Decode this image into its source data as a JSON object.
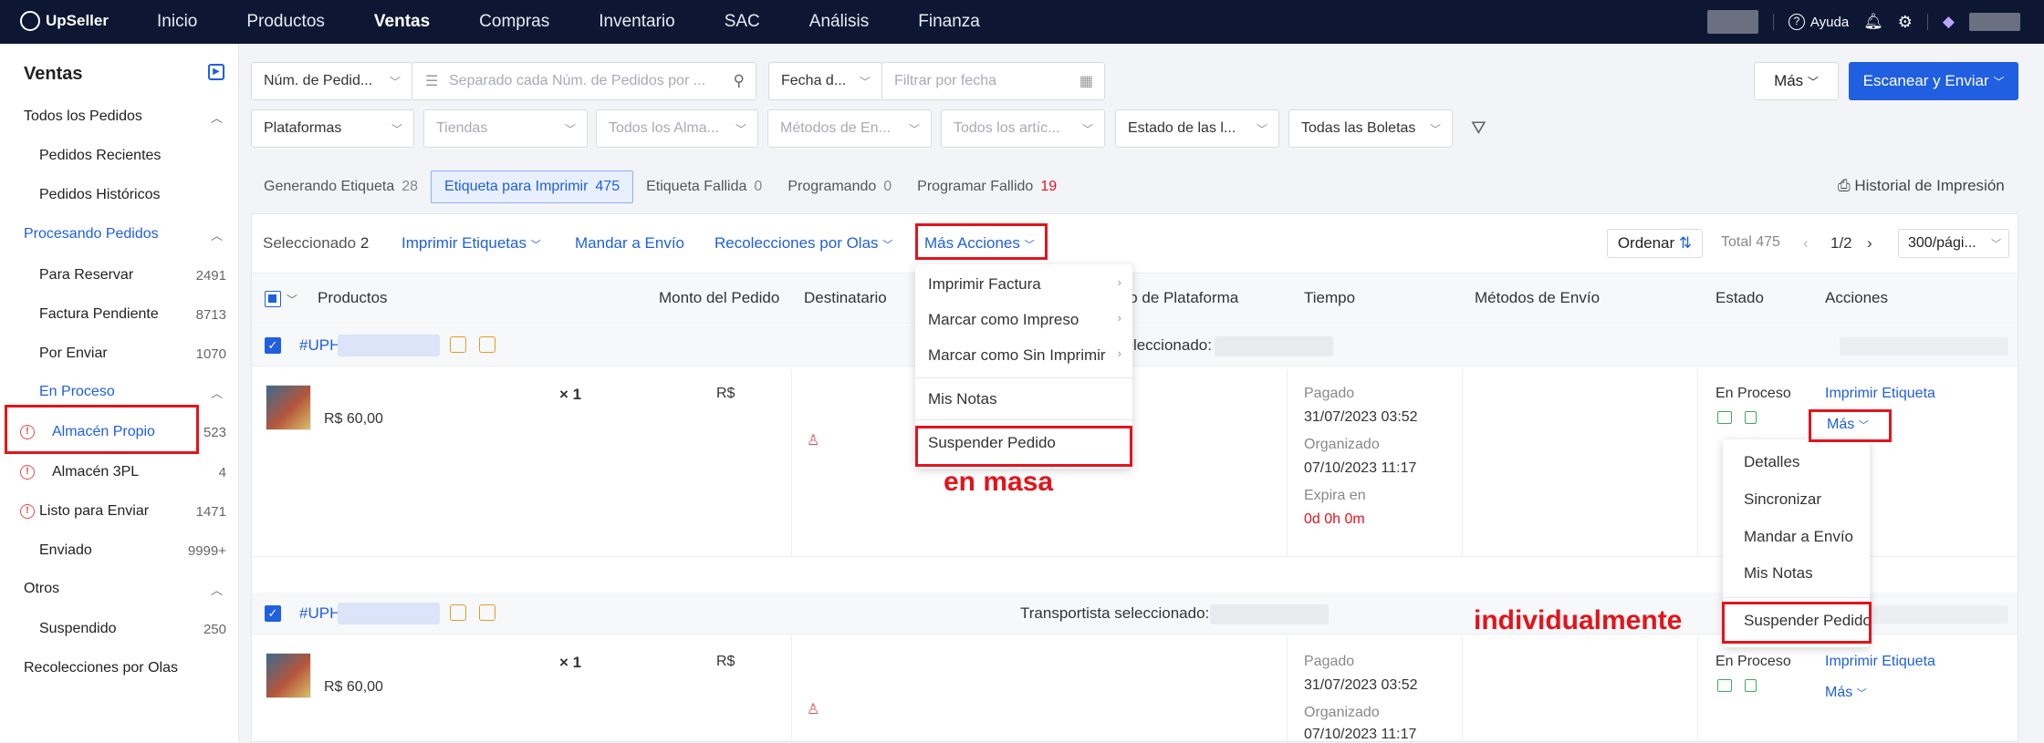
{
  "topbar": {
    "brand": "UpSeller",
    "nav": [
      "Inicio",
      "Productos",
      "Ventas",
      "Compras",
      "Inventario",
      "SAC",
      "Análisis",
      "Finanza"
    ],
    "active_nav": "Ventas",
    "help": "Ayuda"
  },
  "sidebar": {
    "title": "Ventas",
    "todos": "Todos los Pedidos",
    "recientes": "Pedidos Recientes",
    "historicos": "Pedidos Históricos",
    "procesando": "Procesando Pedidos",
    "reservar": {
      "label": "Para Reservar",
      "count": "2491"
    },
    "factura": {
      "label": "Factura Pendiente",
      "count": "8713"
    },
    "enviar": {
      "label": "Por Enviar",
      "count": "1070"
    },
    "en_proceso": "En Proceso",
    "almacen_propio": {
      "label": "Almacén Propio",
      "count": "523"
    },
    "almacen_3pl": {
      "label": "Almacén 3PL",
      "count": "4"
    },
    "listo": {
      "label": "Listo para Enviar",
      "count": "1471"
    },
    "enviado": {
      "label": "Enviado",
      "count": "9999+"
    },
    "otros": "Otros",
    "suspendido": {
      "label": "Suspendido",
      "count": "250"
    },
    "olas": "Recolecciones por Olas"
  },
  "filters": {
    "num_pedido": "Núm. de Pedid...",
    "separado_ph": "Separado cada Núm. de Pedidos por ...",
    "fecha": "Fecha d...",
    "filtrar_fecha_ph": "Filtrar por fecha",
    "plataformas": "Plataformas",
    "tiendas": "Tiendas",
    "almacenes": "Todos los Alma...",
    "metodos": "Métodos de En...",
    "articulos": "Todos los artíc...",
    "estado_boletas": "Estado de las l...",
    "todas_boletas": "Todas las Boletas",
    "mas": "Más",
    "escanear": "Escanear y Enviar"
  },
  "tabs": [
    {
      "label": "Generando Etiqueta",
      "count": "28"
    },
    {
      "label": "Etiqueta para Imprimir",
      "count": "475"
    },
    {
      "label": "Etiqueta Fallida",
      "count": "0"
    },
    {
      "label": "Programando",
      "count": "0"
    },
    {
      "label": "Programar Fallido",
      "count": "19"
    }
  ],
  "historial": "Historial de Impresión",
  "actions": {
    "seleccionado_label": "Seleccionado",
    "seleccionado_count": "2",
    "imprimir_etiquetas": "Imprimir Etiquetas",
    "mandar_envio": "Mandar a Envío",
    "recolecciones": "Recolecciones por Olas",
    "mas_acciones": "Más Acciones",
    "ordenar": "Ordenar",
    "total": "Total 475",
    "page": "1/2",
    "per_page": "300/pági..."
  },
  "columns": {
    "productos": "Productos",
    "monto": "Monto del Pedido",
    "destinatario": "Destinatario",
    "plataforma": "ido de Plataforma",
    "tiempo": "Tiempo",
    "metodos": "Métodos de Envío",
    "estado": "Estado",
    "acciones": "Acciones"
  },
  "orders": [
    {
      "id": "#UPH",
      "transportista": "seleccionado:",
      "qty": "× 1",
      "price": "R$ 60,00",
      "monto": "R$",
      "pagado_label": "Pagado",
      "pagado": "31/07/2023 03:52",
      "organizado_label": "Organizado",
      "organizado": "07/10/2023 11:17",
      "expira_label": "Expira en",
      "expira": "0d 0h 0m",
      "estado": "En Proceso",
      "imprimir": "Imprimir Etiqueta",
      "mas": "Más"
    },
    {
      "id": "#UPH",
      "transportista": "Transportista seleccionado:",
      "qty": "× 1",
      "price": "R$ 60,00",
      "monto": "R$",
      "pagado_label": "Pagado",
      "pagado": "31/07/2023 03:52",
      "organizado_label": "Organizado",
      "organizado": "07/10/2023 11:17",
      "estado": "En Proceso",
      "imprimir": "Imprimir Etiqueta",
      "mas": "Más"
    }
  ],
  "bulk_menu": {
    "factura": "Imprimir Factura",
    "impreso": "Marcar como Impreso",
    "sin_imprimir": "Marcar como Sin Imprimir",
    "notas": "Mis Notas",
    "suspender": "Suspender Pedido"
  },
  "row_menu": {
    "detalles": "Detalles",
    "sincronizar": "Sincronizar",
    "mandar": "Mandar a Envío",
    "notas": "Mis Notas",
    "suspender": "Suspender Pedido"
  },
  "annotations": {
    "en_masa": "en masa",
    "individual": "individualmente"
  },
  "colors": {
    "accent": "#1f5fe0",
    "annotation": "#e3141b",
    "topbar": "#0d1733"
  }
}
